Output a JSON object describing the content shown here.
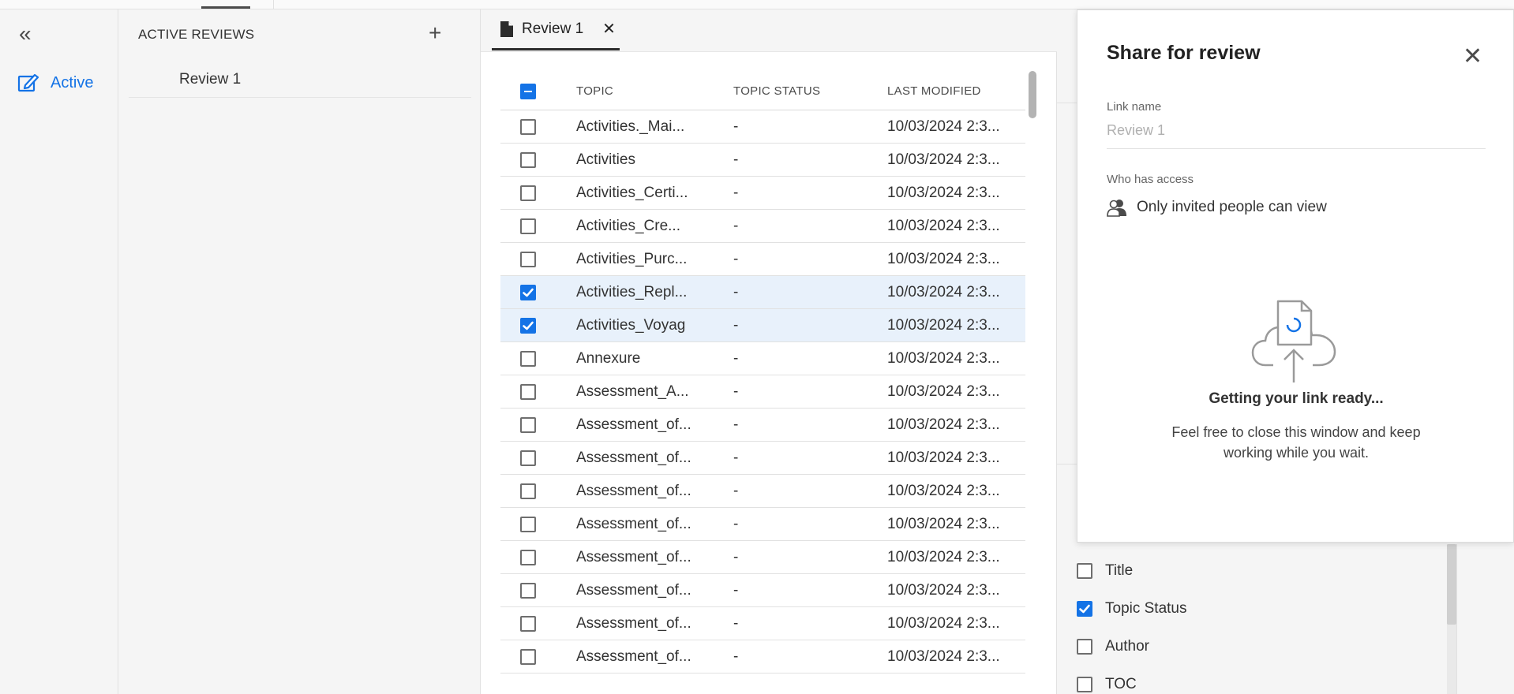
{
  "sidebar": {
    "active_label": "Active"
  },
  "reviews": {
    "heading": "ACTIVE REVIEWS",
    "items": [
      {
        "label": "Review 1"
      }
    ]
  },
  "doc_tab": {
    "label": "Review 1",
    "close": "✕"
  },
  "table": {
    "columns": [
      "TOPIC",
      "TOPIC STATUS",
      "LAST MODIFIED"
    ],
    "header_checkbox": "mixed",
    "rows": [
      {
        "topic": "Activities._Mai...",
        "status": "-",
        "modified": "10/03/2024 2:3...",
        "checked": false
      },
      {
        "topic": "Activities",
        "status": "-",
        "modified": "10/03/2024 2:3...",
        "checked": false
      },
      {
        "topic": "Activities_Certi...",
        "status": "-",
        "modified": "10/03/2024 2:3...",
        "checked": false
      },
      {
        "topic": "Activities_Cre...",
        "status": "-",
        "modified": "10/03/2024 2:3...",
        "checked": false
      },
      {
        "topic": "Activities_Purc...",
        "status": "-",
        "modified": "10/03/2024 2:3...",
        "checked": false
      },
      {
        "topic": "Activities_Repl...",
        "status": "-",
        "modified": "10/03/2024 2:3...",
        "checked": true
      },
      {
        "topic": "Activities_Voyag",
        "status": "-",
        "modified": "10/03/2024 2:3...",
        "checked": true
      },
      {
        "topic": "Annexure",
        "status": "-",
        "modified": "10/03/2024 2:3...",
        "checked": false
      },
      {
        "topic": "Assessment_A...",
        "status": "-",
        "modified": "10/03/2024 2:3...",
        "checked": false
      },
      {
        "topic": "Assessment_of...",
        "status": "-",
        "modified": "10/03/2024 2:3...",
        "checked": false
      },
      {
        "topic": "Assessment_of...",
        "status": "-",
        "modified": "10/03/2024 2:3...",
        "checked": false
      },
      {
        "topic": "Assessment_of...",
        "status": "-",
        "modified": "10/03/2024 2:3...",
        "checked": false
      },
      {
        "topic": "Assessment_of...",
        "status": "-",
        "modified": "10/03/2024 2:3...",
        "checked": false
      },
      {
        "topic": "Assessment_of...",
        "status": "-",
        "modified": "10/03/2024 2:3...",
        "checked": false
      },
      {
        "topic": "Assessment_of...",
        "status": "-",
        "modified": "10/03/2024 2:3...",
        "checked": false
      },
      {
        "topic": "Assessment_of...",
        "status": "-",
        "modified": "10/03/2024 2:3...",
        "checked": false
      },
      {
        "topic": "Assessment_of...",
        "status": "-",
        "modified": "10/03/2024 2:3...",
        "checked": false
      }
    ]
  },
  "share_panel": {
    "title": "Share for review",
    "link_name_label": "Link name",
    "link_name_value": "Review 1",
    "access_label": "Who has access",
    "access_value": "Only invited people can view",
    "ready_title": "Getting your link ready...",
    "ready_message": "Feel free to close this window and keep working while you wait."
  },
  "column_options": [
    {
      "label": "Title",
      "checked": false
    },
    {
      "label": "Topic Status",
      "checked": true
    },
    {
      "label": "Author",
      "checked": false
    },
    {
      "label": "TOC",
      "checked": false
    }
  ],
  "colors": {
    "accent": "#1473e6",
    "selected_row": "#e8f1fb"
  }
}
